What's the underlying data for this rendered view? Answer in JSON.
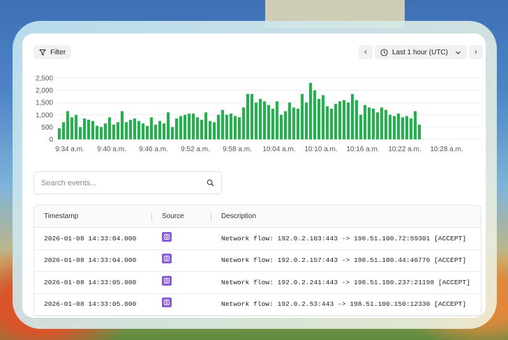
{
  "toolbar": {
    "filter_label": "Filter",
    "prev_label": "‹",
    "next_label": "›",
    "range_label": "Last 1 hour (UTC)"
  },
  "chart_data": {
    "type": "bar",
    "title": "",
    "xlabel": "",
    "ylabel": "",
    "ylim": [
      0,
      2500
    ],
    "yticks": [
      0,
      500,
      1000,
      1500,
      2000,
      2500
    ],
    "ytick_labels": [
      "0",
      "500",
      "1,000",
      "1,500",
      "2,000",
      "2,500"
    ],
    "xtick_labels": [
      "9:34 a.m.",
      "9:40 a.m.",
      "9:46 a.m.",
      "9:52 a.m.",
      "9:58 a.m.",
      "10:04 a.m.",
      "10:10 a.m.",
      "10:16 a.m.",
      "10:22 a.m.",
      "10:28 a.m."
    ],
    "grid": true,
    "color": "#22b14c",
    "values": [
      450,
      700,
      1150,
      900,
      1000,
      500,
      850,
      800,
      750,
      550,
      500,
      650,
      900,
      600,
      700,
      1150,
      700,
      800,
      850,
      750,
      650,
      550,
      900,
      600,
      750,
      650,
      1100,
      500,
      850,
      950,
      1000,
      1050,
      1050,
      900,
      800,
      1100,
      750,
      700,
      1000,
      1200,
      1000,
      1050,
      950,
      900,
      1300,
      1850,
      1850,
      1500,
      1650,
      1550,
      1400,
      1250,
      1550,
      1000,
      1150,
      1500,
      1300,
      1250,
      1850,
      1500,
      2300,
      2000,
      1650,
      1800,
      1350,
      1250,
      1450,
      1550,
      1600,
      1500,
      1850,
      1600,
      1000,
      1400,
      1300,
      1250,
      1100,
      1300,
      1200,
      1000,
      950,
      1050,
      900,
      950,
      850,
      1150,
      600
    ]
  },
  "search": {
    "placeholder": "Search events..."
  },
  "table": {
    "headers": [
      "Timestamp",
      "Source",
      "Description"
    ],
    "rows": [
      {
        "timestamp": "2026-01-08 14:33:04.000",
        "source": "network-icon",
        "description": "Network flow: 192.0.2.103:443 -> 198.51.100.72:59301 [ACCEPT]"
      },
      {
        "timestamp": "2026-01-08 14:33:04.000",
        "source": "network-icon",
        "description": "Network flow: 192.0.2.157:443 -> 198.51.100.44:40776 [ACCEPT]"
      },
      {
        "timestamp": "2026-01-08 14:33:05.000",
        "source": "network-icon",
        "description": "Network flow: 192.0.2.241:443 -> 198.51.100.237:21198 [ACCEPT]"
      },
      {
        "timestamp": "2026-01-08 14:33:05.000",
        "source": "network-icon",
        "description": "Network flow: 192.0.2.53:443 -> 198.51.100.150:12330 [ACCEPT]"
      }
    ]
  }
}
